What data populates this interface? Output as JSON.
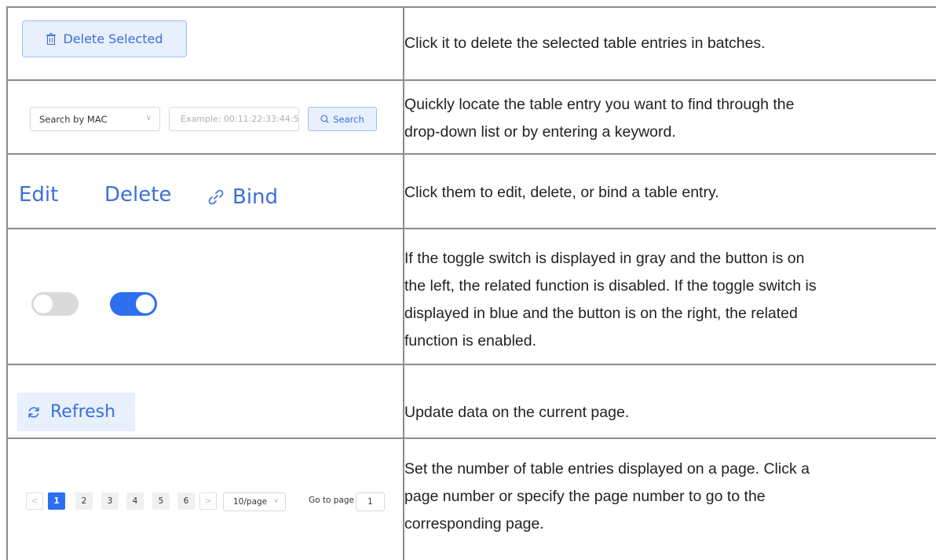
{
  "rows": [
    {
      "control": {
        "delete_selected_label": "Delete Selected"
      },
      "description": "Click it to delete the selected table entries in batches."
    },
    {
      "control": {
        "select_value": "Search by MAC",
        "input_placeholder": "Example: 00:11:22:33:44:5",
        "search_label": "Search"
      },
      "description_lines": [
        "Quickly locate the table entry you want to find through the",
        "drop-down list or by entering a keyword."
      ]
    },
    {
      "control": {
        "edit_label": "Edit",
        "delete_label": "Delete",
        "bind_label": "Bind"
      },
      "description": "Click them to edit, delete, or bind a table entry."
    },
    {
      "control": {
        "toggle_off_state": false,
        "toggle_on_state": true
      },
      "description_lines": [
        "If the toggle switch is displayed in gray and the button is on",
        "the left, the related function is disabled. If the toggle switch is",
        "displayed in blue and the button is on the right, the related",
        "function is enabled."
      ]
    },
    {
      "control": {
        "refresh_label": "Refresh"
      },
      "description": "Update data on the current page."
    },
    {
      "control": {
        "prev_arrow": "<",
        "pages": [
          "1",
          "2",
          "3",
          "4",
          "5",
          "6"
        ],
        "active_page": "1",
        "next_arrow": ">",
        "page_size": "10/page",
        "goto_label": "Go to page",
        "goto_value": "1"
      },
      "description_lines": [
        "Set the number of table entries displayed on a page. Click a",
        "page number or specify the page number to go to the",
        "corresponding page."
      ]
    }
  ],
  "colors": {
    "accent": "#3b6fd8",
    "accent_bg": "#e8f0fe",
    "toggle_on": "#2c6ff0",
    "toggle_off": "#d9d9d9",
    "table_border": "#8c8c8c"
  },
  "icons": [
    "trash-icon",
    "chevron-down-icon",
    "search-icon",
    "link-icon",
    "refresh-icon",
    "chevron-left-icon",
    "chevron-right-icon"
  ]
}
